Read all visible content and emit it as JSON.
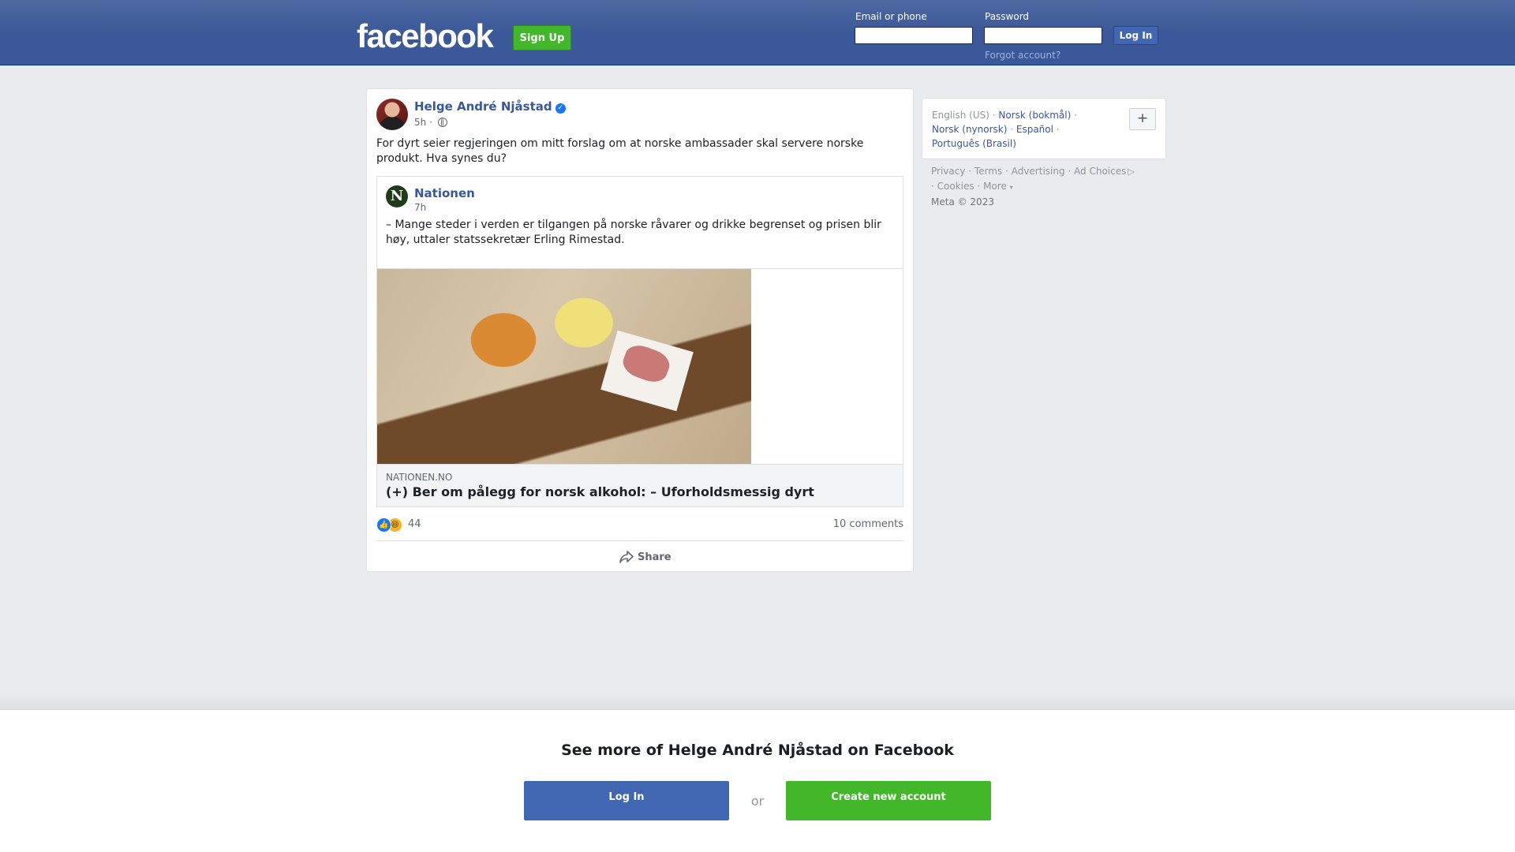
{
  "header": {
    "logo_text": "facebook",
    "signup_label": "Sign Up",
    "email_label": "Email or phone",
    "email_value": "",
    "password_label": "Password",
    "password_value": "",
    "login_label": "Log In",
    "forgot_label": "Forgot account?"
  },
  "post": {
    "author": "Helge André Njåstad",
    "time": "5h",
    "separator": "·",
    "text": "For dyrt seier regjeringen om mitt forslag om at norske ambassader skal servere norske produkt. Hva synes du?",
    "shared": {
      "logo_letter": "N",
      "page_name": "Nationen",
      "time": "7h",
      "text": "– Mange steder i verden er tilgangen på norske råvarer og drikke begrenset og prisen blir høy, uttaler statssekretær Erling Rimestad.",
      "link_domain": "NATIONEN.NO",
      "link_title": "(+) Ber om pålegg for norsk alkohol: – Uforholdsmessig dyrt"
    },
    "reaction_count": "44",
    "comments": "10 comments",
    "share_label": "Share"
  },
  "sidebar": {
    "languages": {
      "current": "English (US)",
      "links": [
        "Norsk (bokmål)",
        "Norsk (nynorsk)",
        "Español",
        "Português (Brasil)"
      ]
    },
    "plus_label": "+",
    "footer_links": [
      "Privacy",
      "Terms",
      "Advertising",
      "Ad Choices",
      "Cookies",
      "More"
    ],
    "copyright": "Meta © 2023"
  },
  "banner": {
    "title": "See more of Helge André Njåstad on Facebook",
    "login_label": "Log In",
    "or_label": "or",
    "create_label": "Create new account"
  },
  "colors": {
    "header_blue": "#3b5998",
    "link_blue": "#385898",
    "green": "#42b72a",
    "button_blue": "#4267b2"
  }
}
